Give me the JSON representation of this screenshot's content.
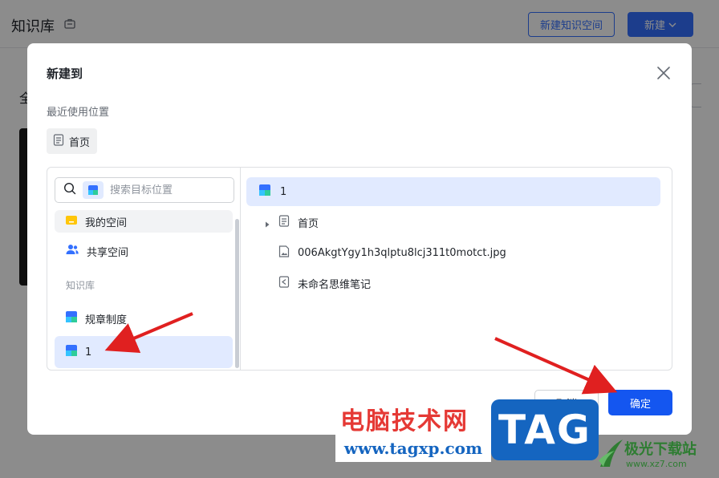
{
  "app": {
    "title": "知识库",
    "new_space_button": "新建知识空间",
    "new_button": "新建",
    "left_partial_text": "全"
  },
  "dialog": {
    "title": "新建到",
    "recent_label": "最近使用位置",
    "recent_chip": "首页",
    "search_placeholder": "搜索目标位置",
    "left_tree": {
      "my_space": "我的空间",
      "shared_space": "共享空间",
      "section_label": "知识库",
      "items": [
        "规章制度",
        "1"
      ]
    },
    "right_tree": {
      "root": "1",
      "children": [
        "首页",
        "006AkgtYgy1h3qlptu8lcj311t0motct.jpg",
        "未命名思维笔记"
      ]
    },
    "cancel_button": "取消",
    "confirm_button": "确定"
  },
  "watermark": {
    "site_name": "电脑技术网",
    "site_url": "www.tagxp.com",
    "tag": "TAG",
    "right_name": "极光下载站",
    "right_url": "www.xz7.com"
  },
  "colors": {
    "accent": "#3370ff",
    "confirm": "#1456f0",
    "selected_bg": "#e1eaff",
    "annotation_arrow": "#e02020"
  }
}
